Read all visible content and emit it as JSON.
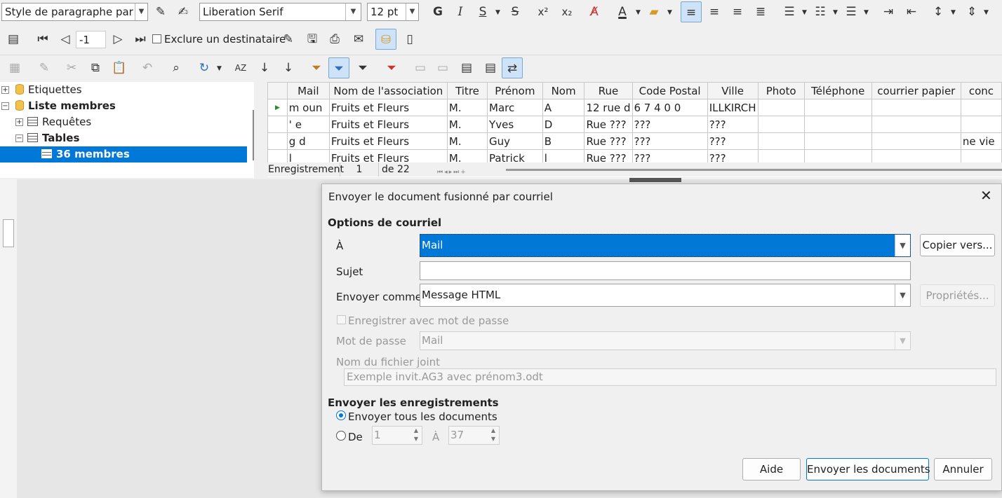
{
  "toolbar1": {
    "paragraph_style": "Style de paragraphe par déf",
    "font_name": "Liberation Serif",
    "font_size": "12 pt",
    "bold": "G",
    "italic": "I",
    "underline": "S",
    "strike": "S",
    "superscript": "x²",
    "subscript": "x₂"
  },
  "toolbar2": {
    "record_number": "-1",
    "exclude_label": "Exclure un destinataire"
  },
  "tree": {
    "items": [
      {
        "label": "Etiquettes",
        "icon": "database-icon"
      },
      {
        "label": "Liste membres",
        "icon": "database-icon"
      },
      {
        "label": "Requêtes",
        "icon": "queries-icon"
      },
      {
        "label": "Tables",
        "icon": "table-icon"
      },
      {
        "label": "36 membres",
        "icon": "table-icon"
      }
    ]
  },
  "grid": {
    "headers": [
      "Mail",
      "Nom de l'association",
      "Titre",
      "Prénom",
      "Nom",
      "Rue",
      "Code Postal",
      "Ville",
      "Photo",
      "Téléphone",
      "courrier papier",
      "conc"
    ],
    "rows": [
      [
        "m   oun",
        "Fruits et Fleurs",
        "M.",
        "Marc",
        "A",
        "12 rue d",
        "6 7 4 0 0",
        "ILLKIRCH",
        "",
        "",
        "",
        ""
      ],
      [
        "'     e",
        "Fruits et Fleurs",
        "M.",
        "Yves",
        "D",
        "Rue ???",
        "???",
        "???",
        "",
        "",
        "",
        ""
      ],
      [
        "g     d",
        "Fruits et Fleurs",
        "M.",
        "Guy",
        "B",
        "Rue ???",
        "???",
        "???",
        "",
        "",
        "",
        "ne vie"
      ],
      [
        "l     ",
        "Fruits et Fleurs",
        "M.",
        "Patrick",
        "l",
        "Rue ???",
        "???",
        "???",
        "",
        "",
        "",
        ""
      ]
    ]
  },
  "navbar": {
    "label": "Enregistrement",
    "current": "1",
    "total": "de 22"
  },
  "dialog": {
    "title": "Envoyer le document fusionné par courriel",
    "section_mail": "Options de courriel",
    "to_label": "À",
    "to_value": "Mail",
    "copy_button": "Copier vers...",
    "subject_label": "Sujet",
    "subject_value": "",
    "send_as_label": "Envoyer comme",
    "send_as_value": "Message HTML",
    "properties_button": "Propriétés...",
    "save_password_label": "Enregistrer avec mot de passe",
    "password_label": "Mot de passe",
    "password_value": "Mail",
    "attachment_label": "Nom du fichier joint",
    "attachment_value": "Exemple invit.AG3 avec prénom3.odt",
    "section_records": "Envoyer les enregistrements",
    "all_docs_label": "Envoyer tous les documents",
    "from_label": "De",
    "from_value": "1",
    "to2_label": "À",
    "to2_value": "37",
    "help_button": "Aide",
    "send_button": "Envoyer les documents",
    "cancel_button": "Annuler"
  },
  "colors": {
    "accent": "#0078d7",
    "selection": "#0078d7",
    "toolbar_bg": "#f0f0f0"
  }
}
